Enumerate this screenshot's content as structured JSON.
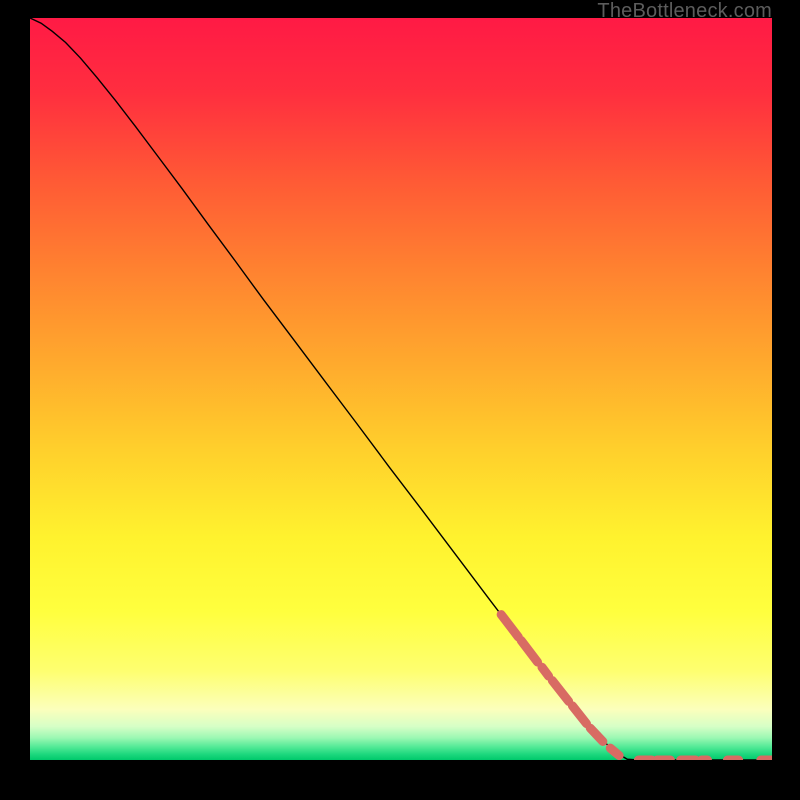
{
  "watermark": "TheBottleneck.com",
  "chart_data": {
    "type": "line",
    "title": "",
    "xlabel": "",
    "ylabel": "",
    "xlim": [
      0,
      100
    ],
    "ylim": [
      0,
      100
    ],
    "grid": false,
    "series": [
      {
        "name": "curve",
        "style": "solid-black",
        "points": [
          {
            "x": 0.0,
            "y": 100.0
          },
          {
            "x": 1.5,
            "y": 99.3
          },
          {
            "x": 3.0,
            "y": 98.2
          },
          {
            "x": 4.8,
            "y": 96.7
          },
          {
            "x": 6.8,
            "y": 94.6
          },
          {
            "x": 9.0,
            "y": 92.0
          },
          {
            "x": 11.5,
            "y": 88.9
          },
          {
            "x": 14.2,
            "y": 85.4
          },
          {
            "x": 17.2,
            "y": 81.4
          },
          {
            "x": 20.5,
            "y": 77.0
          },
          {
            "x": 24.0,
            "y": 72.2
          },
          {
            "x": 27.7,
            "y": 67.2
          },
          {
            "x": 31.5,
            "y": 62.0
          },
          {
            "x": 35.5,
            "y": 56.7
          },
          {
            "x": 39.7,
            "y": 51.1
          },
          {
            "x": 44.0,
            "y": 45.4
          },
          {
            "x": 48.4,
            "y": 39.5
          },
          {
            "x": 52.9,
            "y": 33.6
          },
          {
            "x": 57.5,
            "y": 27.5
          },
          {
            "x": 62.1,
            "y": 21.4
          },
          {
            "x": 66.7,
            "y": 15.4
          },
          {
            "x": 71.3,
            "y": 9.5
          },
          {
            "x": 75.5,
            "y": 4.3
          },
          {
            "x": 78.8,
            "y": 1.1
          },
          {
            "x": 80.5,
            "y": 0.1
          },
          {
            "x": 82.0,
            "y": 0.0
          },
          {
            "x": 100.0,
            "y": 0.0
          }
        ]
      },
      {
        "name": "dash-markers",
        "style": "salmon-dashes",
        "segments": [
          {
            "x1": 63.5,
            "y1": 19.6,
            "x2": 65.8,
            "y2": 16.6
          },
          {
            "x1": 66.2,
            "y1": 16.1,
            "x2": 68.4,
            "y2": 13.2
          },
          {
            "x1": 69.0,
            "y1": 12.5,
            "x2": 69.9,
            "y2": 11.3
          },
          {
            "x1": 70.4,
            "y1": 10.7,
            "x2": 72.6,
            "y2": 7.9
          },
          {
            "x1": 73.1,
            "y1": 7.3,
            "x2": 75.0,
            "y2": 4.9
          },
          {
            "x1": 75.5,
            "y1": 4.3,
            "x2": 77.2,
            "y2": 2.5
          },
          {
            "x1": 78.2,
            "y1": 1.6,
            "x2": 79.4,
            "y2": 0.6
          },
          {
            "x1": 82.0,
            "y1": 0.0,
            "x2": 83.8,
            "y2": 0.0
          },
          {
            "x1": 84.5,
            "y1": 0.0,
            "x2": 86.3,
            "y2": 0.0
          },
          {
            "x1": 87.7,
            "y1": 0.0,
            "x2": 89.7,
            "y2": 0.0
          },
          {
            "x1": 90.5,
            "y1": 0.0,
            "x2": 91.3,
            "y2": 0.0
          },
          {
            "x1": 94.0,
            "y1": 0.0,
            "x2": 95.5,
            "y2": 0.0
          },
          {
            "x1": 98.5,
            "y1": 0.0,
            "x2": 100.0,
            "y2": 0.0
          }
        ]
      }
    ],
    "background_gradient_stops": [
      {
        "offset": 0.0,
        "color": "#ff1a45"
      },
      {
        "offset": 0.1,
        "color": "#ff2e3f"
      },
      {
        "offset": 0.22,
        "color": "#ff5a35"
      },
      {
        "offset": 0.34,
        "color": "#ff8230"
      },
      {
        "offset": 0.46,
        "color": "#ffa82d"
      },
      {
        "offset": 0.58,
        "color": "#ffcf2c"
      },
      {
        "offset": 0.7,
        "color": "#fff22e"
      },
      {
        "offset": 0.8,
        "color": "#ffff3e"
      },
      {
        "offset": 0.88,
        "color": "#feff70"
      },
      {
        "offset": 0.932,
        "color": "#fbffbc"
      },
      {
        "offset": 0.955,
        "color": "#d6ffc6"
      },
      {
        "offset": 0.97,
        "color": "#9cf8b3"
      },
      {
        "offset": 0.982,
        "color": "#55ea97"
      },
      {
        "offset": 0.992,
        "color": "#1ed87e"
      },
      {
        "offset": 1.0,
        "color": "#00c96b"
      }
    ],
    "dash_color": "#d86b63"
  }
}
